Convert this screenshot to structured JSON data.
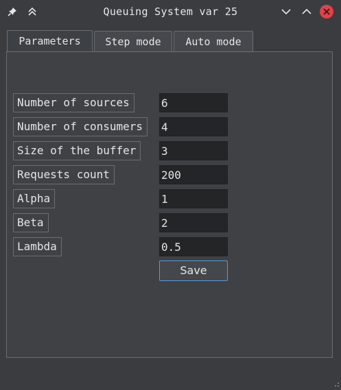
{
  "window": {
    "title": "Queuing System var 25",
    "icons": [
      "pin-icon",
      "keep-above-icon",
      "minimize-icon",
      "maximize-icon",
      "close-icon"
    ],
    "close_color": "#e0424a"
  },
  "tabs": [
    {
      "label": "Parameters",
      "active": true
    },
    {
      "label": "Step mode",
      "active": false
    },
    {
      "label": "Auto mode",
      "active": false
    }
  ],
  "form": {
    "fields": [
      {
        "label": "Number of sources",
        "value": "6"
      },
      {
        "label": "Number of consumers",
        "value": "4"
      },
      {
        "label": "Size of the buffer",
        "value": "3"
      },
      {
        "label": "Requests count",
        "value": "200"
      },
      {
        "label": "Alpha",
        "value": "1"
      },
      {
        "label": "Beta",
        "value": "2"
      },
      {
        "label": "Lambda",
        "value": "0.5"
      }
    ],
    "save_label": "Save"
  },
  "colors": {
    "background": "#3a3c3f",
    "panel": "#3f4145",
    "input_bg": "#232527",
    "accent_border": "#5a9bd5"
  }
}
